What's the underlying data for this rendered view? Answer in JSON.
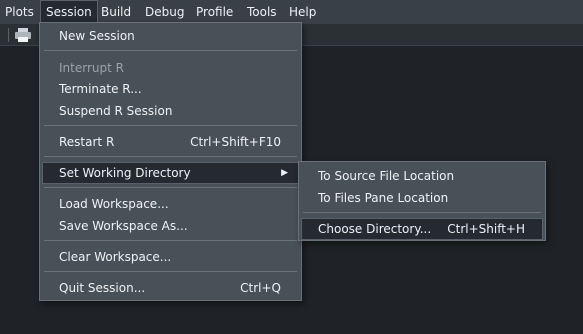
{
  "menubar": {
    "items": [
      {
        "label": "Plots"
      },
      {
        "label": "Session"
      },
      {
        "label": "Build"
      },
      {
        "label": "Debug"
      },
      {
        "label": "Profile"
      },
      {
        "label": "Tools"
      },
      {
        "label": "Help"
      }
    ]
  },
  "session_menu": {
    "new_session": "New Session",
    "interrupt_r": "Interrupt R",
    "terminate_r": "Terminate R...",
    "suspend_r_session": "Suspend R Session",
    "restart_r": "Restart R",
    "restart_r_shortcut": "Ctrl+Shift+F10",
    "set_working_directory": "Set Working Directory",
    "load_workspace": "Load Workspace...",
    "save_workspace_as": "Save Workspace As...",
    "clear_workspace": "Clear Workspace...",
    "quit_session": "Quit Session...",
    "quit_session_shortcut": "Ctrl+Q"
  },
  "working_directory_submenu": {
    "to_source_file_location": "To Source File Location",
    "to_files_pane_location": "To Files Pane Location",
    "choose_directory": "Choose Directory...",
    "choose_directory_shortcut": "Ctrl+Shift+H"
  },
  "colors": {
    "background": "#1f2327",
    "menu_background": "#495158",
    "highlight": "#242a30"
  }
}
